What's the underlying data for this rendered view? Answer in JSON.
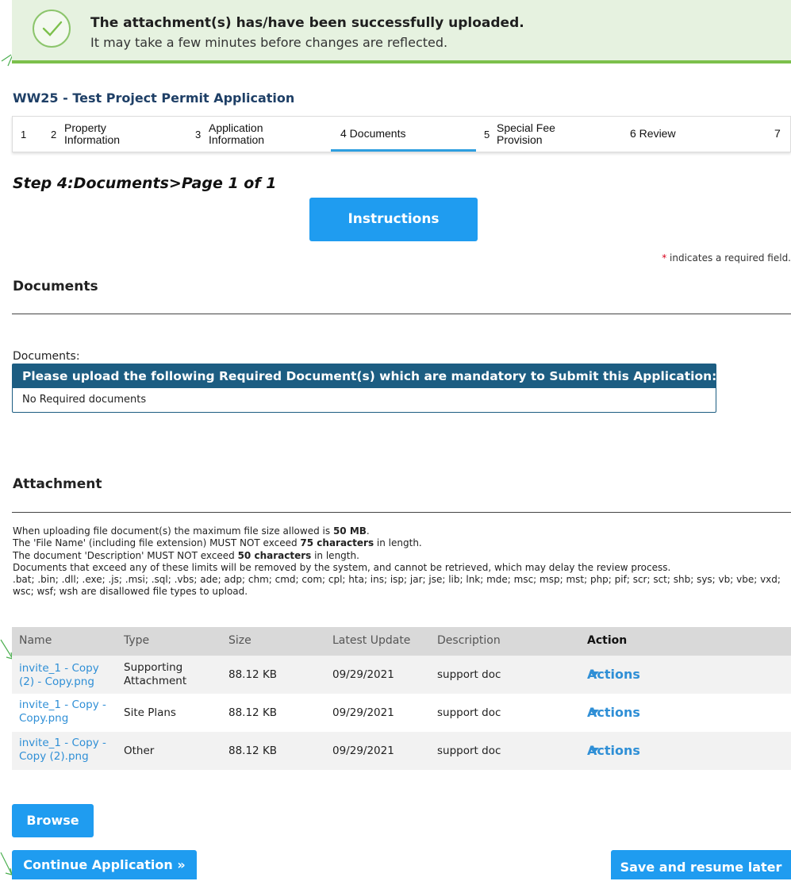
{
  "banner": {
    "title": "The attachment(s) has/have been successfully uploaded.",
    "subtitle": "It may take a few minutes before changes are reflected."
  },
  "page_title": "WW25 - Test Project Permit Application",
  "steps": [
    {
      "num": "1",
      "label": ""
    },
    {
      "num": "2",
      "label_line1": "Property",
      "label_line2": "Information"
    },
    {
      "num": "3",
      "label_line1": "Application",
      "label_line2": "Information"
    },
    {
      "label": "4 Documents",
      "active": true
    },
    {
      "num": "5",
      "label_line1": "Special Fee",
      "label_line2": "Provision"
    },
    {
      "label": "6 Review"
    },
    {
      "label": "7"
    }
  ],
  "step_heading": "Step 4:Documents>Page 1 of 1",
  "instructions_button": "Instructions",
  "required_note": {
    "star": "*",
    "text": " indicates a required field."
  },
  "documents": {
    "section_title": "Documents",
    "label": "Documents:",
    "required_header": "Please upload the following Required Document(s) which are mandatory to Submit this Application:",
    "required_body": "No Required documents"
  },
  "attachment": {
    "section_title": "Attachment",
    "info": {
      "line1_pre": "When uploading file document(s) the maximum file size allowed is ",
      "line1_bold": "50 MB",
      "line1_post": ".",
      "line2_pre": "The 'File Name' (including file extension) MUST NOT exceed ",
      "line2_bold": "75 characters",
      "line2_post": " in length.",
      "line3_pre": "The document 'Description' MUST NOT exceed ",
      "line3_bold": "50 characters",
      "line3_post": " in length.",
      "line4": "Documents that exceed any of these limits will be removed by the system, and cannot be retrieved, which may delay the review process.",
      "line5": ".bat; .bin; .dll; .exe; .js; .msi; .sql; .vbs; ade; adp; chm; cmd; com; cpl; hta; ins; isp; jar; jse; lib; lnk; mde; msc; msp; mst; php; pif; scr; sct; shb; sys; vb; vbe; vxd; wsc; wsf; wsh are disallowed file types to upload."
    },
    "table": {
      "headers": [
        "Name",
        "Type",
        "Size",
        "Latest Update",
        "Description",
        "Action"
      ],
      "rows": [
        {
          "name_line1": "invite_1 - Copy",
          "name_line2": "(2) - Copy.png",
          "type_line1": "Supporting",
          "type_line2": "Attachment",
          "size": "88.12 KB",
          "date": "09/29/2021",
          "desc": "support doc",
          "action": "Actions"
        },
        {
          "name_line1": "invite_1 - Copy -",
          "name_line2": "Copy.png",
          "type_line1": "Site Plans",
          "type_line2": "",
          "size": "88.12 KB",
          "date": "09/29/2021",
          "desc": "support doc",
          "action": "Actions"
        },
        {
          "name_line1": "invite_1 - Copy -",
          "name_line2": "Copy (2).png",
          "type_line1": "Other",
          "type_line2": "",
          "size": "88.12 KB",
          "date": "09/29/2021",
          "desc": "support doc",
          "action": "Actions"
        }
      ]
    }
  },
  "buttons": {
    "browse": "Browse",
    "continue": "Continue Application »",
    "save": "Save and resume later"
  },
  "colors": {
    "accent": "#1f9cf0",
    "banner_bg": "#e6f2e0",
    "banner_border": "#7cc04b",
    "box_header": "#1c5d82",
    "link": "#2f8fd6"
  }
}
